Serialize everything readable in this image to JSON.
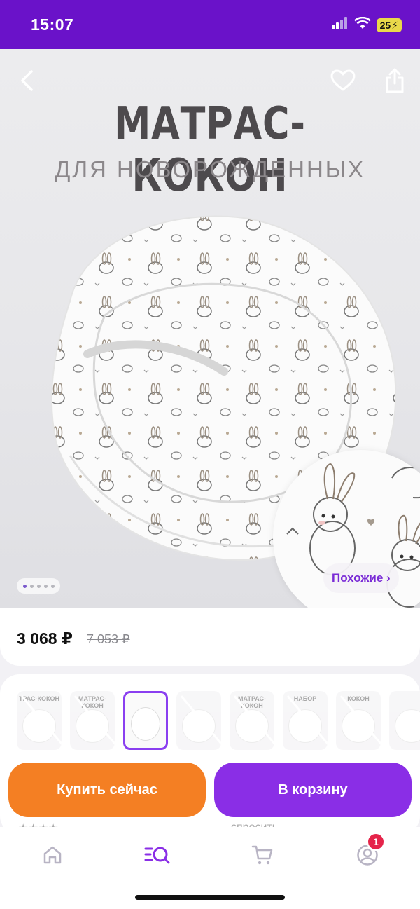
{
  "status_bar": {
    "time": "15:07",
    "battery": "25"
  },
  "product": {
    "image_title": "МАТРАС-КОКОН",
    "image_subtitle": "ДЛЯ НОВОРОЖДЕННЫХ",
    "gallery": {
      "total": 5,
      "current": 1
    },
    "similar_label": "Похожие ›",
    "price_current": "3 068 ₽",
    "price_old": "7 053 ₽"
  },
  "thumbnails": [
    {
      "label": "ТРАС-КОКОН",
      "selected": false
    },
    {
      "label": "МАТРАС-КОКОН",
      "selected": false
    },
    {
      "label": "",
      "selected": true
    },
    {
      "label": "",
      "selected": false
    },
    {
      "label": "МАТРАС-КОКОН",
      "selected": false
    },
    {
      "label": "НАБОР",
      "selected": false
    },
    {
      "label": "КОКОН",
      "selected": false
    },
    {
      "label": "",
      "selected": false
    }
  ],
  "actions": {
    "buy_now": "Купить сейчас",
    "add_to_cart": "В корзину"
  },
  "peek": {
    "right_text": "спросить"
  },
  "tabbar": {
    "profile_badge": "1"
  },
  "colors": {
    "brand": "#6a12c9",
    "buy": "#f47f23",
    "cart": "#8a2ee6",
    "badge": "#e5244a"
  }
}
